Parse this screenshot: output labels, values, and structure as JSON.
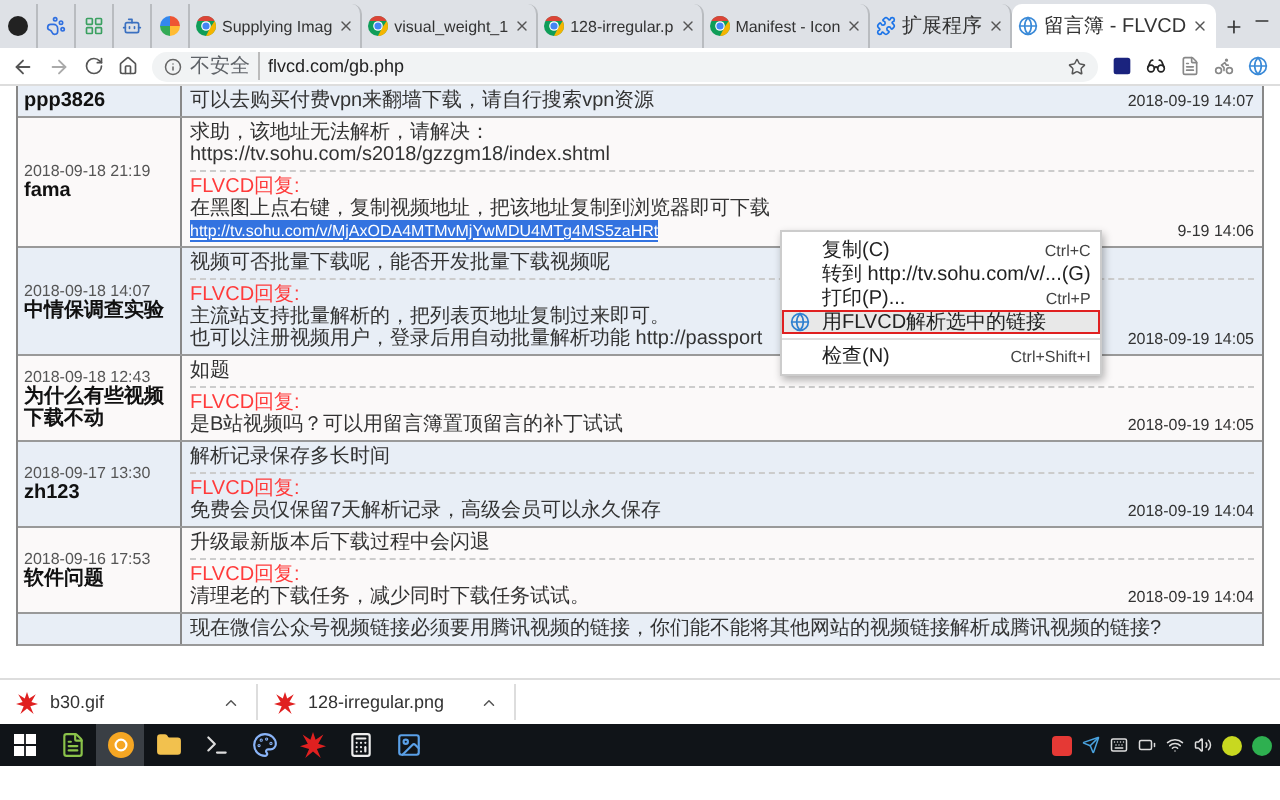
{
  "tabs": [
    {
      "kind": "pinned",
      "selected": false
    },
    {
      "kind": "pinned",
      "selected": false
    },
    {
      "kind": "pinned",
      "selected": false
    },
    {
      "kind": "pinned",
      "selected": false
    },
    {
      "kind": "pinned",
      "selected": false
    },
    {
      "kind": "web",
      "title": "Supplying Imag",
      "selected": false
    },
    {
      "kind": "web",
      "title": "visual_weight_1",
      "selected": false
    },
    {
      "kind": "web",
      "title": "128-irregular.p",
      "selected": false
    },
    {
      "kind": "web",
      "title": "Manifest - Icon",
      "selected": false
    },
    {
      "kind": "extensions",
      "title": "扩展程序",
      "selected": false
    },
    {
      "kind": "site",
      "title": "留言簿 - FLVCD",
      "selected": true
    }
  ],
  "address_bar": {
    "security": "不安全",
    "url": "flvcd.com/gb.php"
  },
  "guestbook": {
    "rows": [
      {
        "name": "ppp3826",
        "reply": [
          "可以去购买付费vpn来翻墙下载，请自行搜索vpn资源"
        ],
        "time": "2018-09-19 14:07"
      },
      {
        "date": "2018-09-18 21:19",
        "name": "fama",
        "question": [
          "求助，该地址无法解析，请解决：",
          "https://tv.sohu.com/s2018/gzzgm18/index.shtml"
        ],
        "reply_label": "FLVCD回复:",
        "reply": [
          "在黑图上点右键，复制视频地址，把该地址复制到浏览器即可下载"
        ],
        "link": {
          "text": "http://tv.sohu.com/v/MjAxODA4MTMvMjYwMDU4MTg4MS5zaHRt",
          "selected": true
        },
        "time": "9-19 14:06"
      },
      {
        "date": "2018-09-18 14:07",
        "name": "中情保调查实验",
        "question": [
          "视频可否批量下载呢，能否开发批量下载视频呢"
        ],
        "reply_label": "FLVCD回复:",
        "reply": [
          "主流站支持批量解析的，把列表页地址复制过来即可。",
          "也可以注册视频用户，登录后用自动批量解析功能 http://passport"
        ],
        "time": "2018-09-19 14:05"
      },
      {
        "date": "2018-09-18 12:43",
        "name": "为什么有些视频下载不动",
        "question": [
          "如题"
        ],
        "reply_label": "FLVCD回复:",
        "reply": [
          "是B站视频吗？可以用留言簿置顶留言的补丁试试"
        ],
        "time": "2018-09-19 14:05"
      },
      {
        "date": "2018-09-17 13:30",
        "name": "zh123",
        "question": [
          "解析记录保存多长时间"
        ],
        "reply_label": "FLVCD回复:",
        "reply": [
          "免费会员仅保留7天解析记录，高级会员可以永久保存"
        ],
        "time": "2018-09-19 14:04"
      },
      {
        "date": "2018-09-16 17:53",
        "name": "软件问题",
        "question": [
          "升级最新版本后下载过程中会闪退"
        ],
        "reply_label": "FLVCD回复:",
        "reply": [
          "清理老的下载任务，减少同时下载任务试试。"
        ],
        "time": "2018-09-19 14:04"
      },
      {
        "question": [
          "现在微信公众号视频链接必须要用腾讯视频的链接，你们能不能将其他网站的视频链接解析成腾讯视频的链接?"
        ]
      }
    ]
  },
  "context_menu": {
    "items": [
      {
        "kind": "plain",
        "label": "复制(C)",
        "shortcut": "Ctrl+C",
        "separator_before": false,
        "selected": false
      },
      {
        "kind": "plain",
        "label": "转到 http://tv.sohu.com/v/...(G)",
        "separator_before": false,
        "selected": false
      },
      {
        "kind": "plain",
        "label": "打印(P)...",
        "shortcut": "Ctrl+P",
        "separator_before": false,
        "selected": false
      },
      {
        "kind": "extension",
        "label": "用FLVCD解析选中的链接",
        "separator_before": false,
        "selected": true
      },
      {
        "kind": "plain",
        "label": "检查(N)",
        "shortcut": "Ctrl+Shift+I",
        "separator_before": true,
        "selected": false
      }
    ]
  },
  "downloads": [
    {
      "name": "b30.gif"
    },
    {
      "name": "128-irregular.png"
    }
  ],
  "taskbar": {
    "apps": [
      {
        "active": false
      },
      {
        "active": true
      },
      {
        "active": false
      },
      {
        "active": false
      },
      {
        "active": false
      },
      {
        "active": false
      },
      {
        "active": false
      },
      {
        "active": false
      }
    ]
  }
}
